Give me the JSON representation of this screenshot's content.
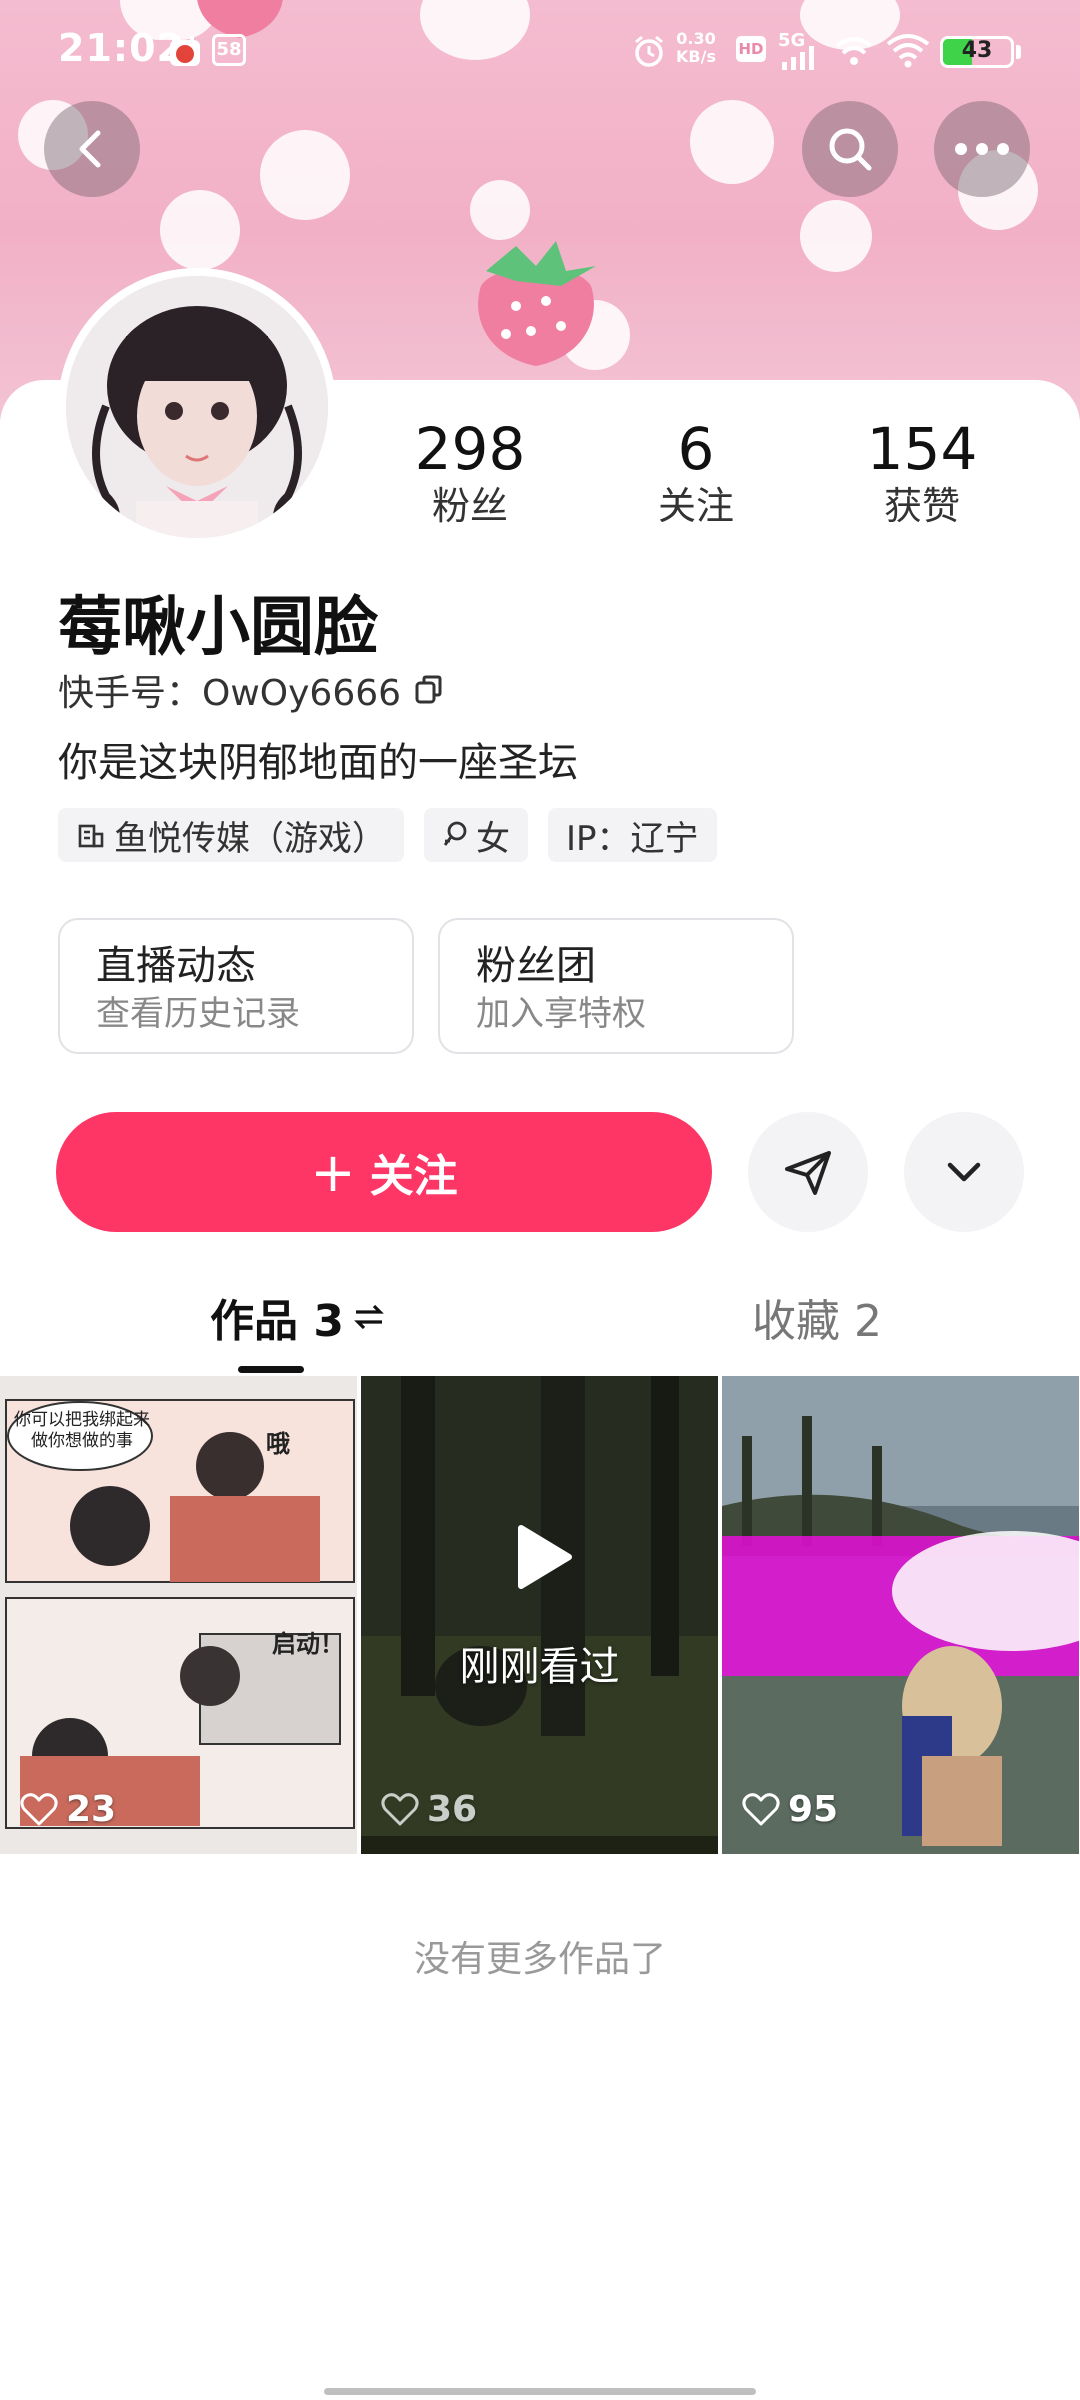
{
  "status_bar": {
    "time": "21:02",
    "badge": "58",
    "net_speed_value": "0.30",
    "net_speed_unit": "KB/s",
    "hd": "HD",
    "signal": "5G",
    "battery": "43",
    "battery_level": 0.43
  },
  "header": {
    "back_icon": "back-chevron-icon",
    "search_icon": "search-icon",
    "more_icon": "more-dots-icon"
  },
  "profile": {
    "stats": [
      {
        "value": "298",
        "label": "粉丝"
      },
      {
        "value": "6",
        "label": "关注"
      },
      {
        "value": "154",
        "label": "获赞"
      }
    ],
    "name": "莓啾小圆脸",
    "id_label": "快手号：OwOy6666",
    "bio": "你是这块阴郁地面的一座圣坛",
    "tags": {
      "company": "鱼悦传媒（游戏）",
      "gender": "女",
      "ip": "IP：辽宁"
    }
  },
  "info_boxes": {
    "live": {
      "title": "直播动态",
      "subtitle": "查看历史记录"
    },
    "fans": {
      "title": "粉丝团",
      "subtitle": "加入享特权"
    }
  },
  "actions": {
    "follow_plus": "+",
    "follow_label": "关注",
    "message_icon": "send-icon",
    "more_icon": "chevron-down-icon"
  },
  "tabs": {
    "works": "作品 3",
    "favorites": "收藏 2"
  },
  "grid": [
    {
      "likes": "23",
      "caption_a": "你可以把我绑起来做你想做的事",
      "caption_b": "哦",
      "caption_c": "启动！"
    },
    {
      "likes": "36",
      "watched": "刚刚看过"
    },
    {
      "likes": "95"
    }
  ],
  "footer": {
    "no_more": "没有更多作品了"
  },
  "colors": {
    "accent": "#fe3666",
    "banner_pink": "#f2b0c6"
  }
}
